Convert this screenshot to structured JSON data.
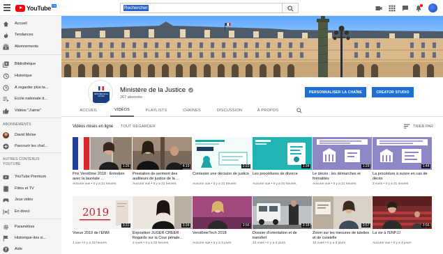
{
  "app": {
    "logo_word": "YouTube",
    "logo_country": "FR",
    "search_placeholder": "Rechercher"
  },
  "sidebar": {
    "items": [
      {
        "label": "Accueil",
        "icon": "home-icon"
      },
      {
        "label": "Tendances",
        "icon": "flame-icon"
      },
      {
        "label": "Abonnements",
        "icon": "subscriptions-icon"
      },
      {
        "label": "Bibliothèque",
        "icon": "library-icon"
      },
      {
        "label": "Historique",
        "icon": "history-icon"
      },
      {
        "label": "À regarder plus ta...",
        "icon": "clock-icon"
      },
      {
        "label": "École nationale d...",
        "icon": "playlist-icon"
      },
      {
        "label": "Vidéos \"J'aime\"",
        "icon": "thumbs-up-icon"
      }
    ],
    "subscriptions_header": "ABONNEMENTS",
    "subscriptions": [
      {
        "label": "David Moïse"
      },
      {
        "label": "Parcourir les chaî..."
      }
    ],
    "more_header": "AUTRES CONTENUS YOUTUBE",
    "more": [
      {
        "label": "YouTube Premium",
        "icon": "youtube-premium-icon"
      },
      {
        "label": "Films et TV",
        "icon": "film-icon"
      },
      {
        "label": "Jeux vidéo",
        "icon": "gaming-icon"
      },
      {
        "label": "En direct",
        "icon": "live-icon"
      }
    ],
    "settings": [
      {
        "label": "Paramètres",
        "icon": "gear-icon"
      },
      {
        "label": "Historique des si...",
        "icon": "flag-icon"
      },
      {
        "label": "Aide",
        "icon": "help-icon"
      }
    ]
  },
  "channel": {
    "name": "Ministère de la Justice",
    "subscribers": "267 abonnés",
    "customize_button": "PERSONNALISER LA CHAÎNE",
    "studio_button": "CREATOR STUDIO",
    "avatar_text": "MINISTÈRE DE LA JUSTICE"
  },
  "tabs": [
    "ACCUEIL",
    "VIDÉOS",
    "PLAYLISTS",
    "CHAÎNES",
    "DISCUSSION",
    "À PROPOS"
  ],
  "active_tab": "VIDÉOS",
  "videos_section": {
    "title": "Vidéos mises en ligne",
    "play_all": "TOUT REGARDER",
    "sort_label": "TRIER PAR"
  },
  "videos": [
    {
      "title": "Prix Vendôme 2018 : Entretien avec la lauréate ...",
      "meta": "Aucune vue • Il y a 21 heures",
      "duration": "1:26"
    },
    {
      "title": "Prestation de serment des auditeurs de justice de la ...",
      "meta": "Aucune vue • Il y a 21 heures",
      "duration": "4:19"
    },
    {
      "title": "Contester une décision de justice",
      "meta": "Aucune vue • Il y a 21 heures",
      "duration": "2:22"
    },
    {
      "title": "Les procédures de divorce",
      "meta": "Aucune vue • Il y a 21 heures",
      "duration": "1:34"
    },
    {
      "title": "Le décès : les démarches et formalités",
      "meta": "Aucune vue • Il y a 21 heures",
      "duration": "1:29"
    },
    {
      "title": "La procédure à suivre en cas de décès",
      "meta": "2 vues • Il y a 21 heures",
      "duration": "1:44"
    },
    {
      "title": "Voeux 2019 de l'ENM",
      "meta": "1 vue • Il y a 22 heures",
      "duration": "3:31"
    },
    {
      "title": "Exposition JUGER CREER : Regards sur la Cour pénale...",
      "meta": "2 vues • Il y a 22 heures",
      "duration": "3:34"
    },
    {
      "title": "VendômeTech 2018",
      "meta": "Aucune vue • Il y a 3 jours",
      "duration": "3:56"
    },
    {
      "title": "Dossier d'orientation et de transfert",
      "meta": "12 vues • Il y a 3 jours",
      "duration": "3:18"
    },
    {
      "title": "Zoom sur les mesures de tutelles et de curatelle",
      "meta": "10 vues • Il y a 3 jours",
      "duration": "3:57"
    },
    {
      "title": "La vie à l'ENPJJ",
      "meta": "Aucune vue • Il y a 3 jours",
      "duration": "3:56"
    }
  ],
  "colors": {
    "youtube_red": "#ff0000",
    "button_blue": "#1f6ed4",
    "sidebar_bg": "#f5f5f5"
  }
}
